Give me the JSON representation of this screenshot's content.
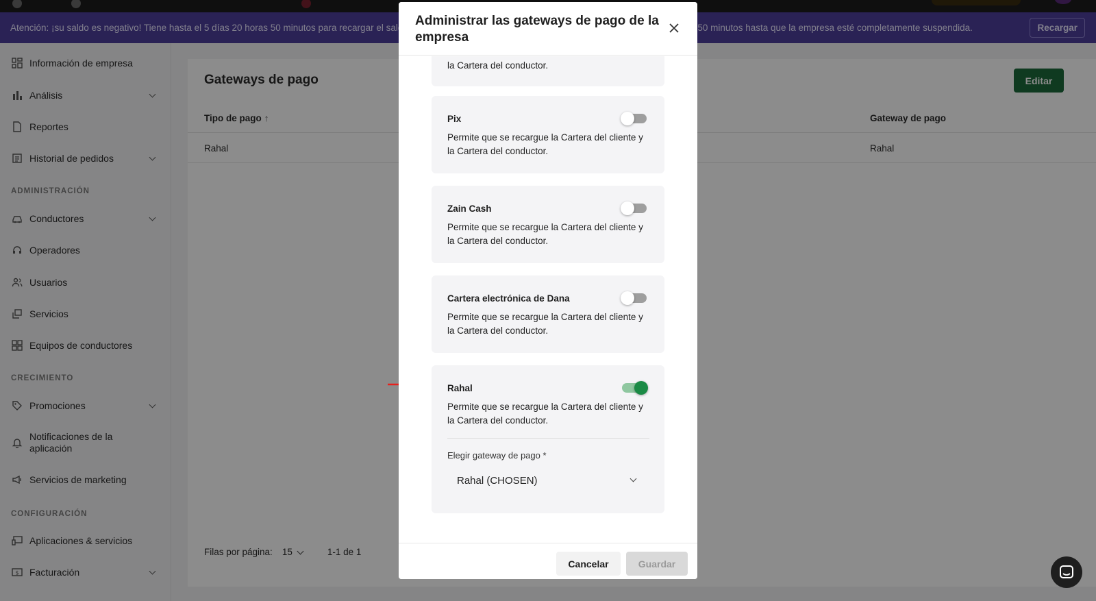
{
  "banner": {
    "text": "Atención: ¡su saldo es negativo! Tiene hasta el 5 días 20 horas 50 minutos para recargar el saldo antes de que la empresa quede suspendida. Quedan 5 días 20 horas 50 minutos hasta que la empresa esté completamente suspendida.",
    "button_label": "Recargar"
  },
  "sidebar": {
    "items": [
      {
        "label": "Información de empresa",
        "icon": "grid-icon"
      },
      {
        "label": "Análisis",
        "icon": "bar-chart-icon"
      },
      {
        "label": "Reportes",
        "icon": "document-icon"
      },
      {
        "label": "Historial de pedidos",
        "icon": "list-icon"
      },
      {
        "label": "Conductores",
        "icon": "car-icon"
      },
      {
        "label": "Operadores",
        "icon": "headset-icon"
      },
      {
        "label": "Usuarios",
        "icon": "users-icon"
      },
      {
        "label": "Servicios",
        "icon": "layers-icon"
      },
      {
        "label": "Equipos de conductores",
        "icon": "team-grid-icon"
      },
      {
        "label": "Promociones",
        "icon": "tag-icon"
      },
      {
        "label": "Notificaciones de la aplicación",
        "icon": "bell-icon"
      },
      {
        "label": "Servicios de marketing",
        "icon": "megaphone-icon"
      },
      {
        "label": "Aplicaciones & servicios",
        "icon": "devices-icon"
      },
      {
        "label": "Facturación",
        "icon": "dollar-icon"
      }
    ],
    "sections": [
      "ADMINISTRACIÓN",
      "CRECIMIENTO",
      "CONFIGURACIÓN"
    ]
  },
  "main": {
    "title": "Gateways de pago",
    "edit_label": "Editar",
    "columns": [
      "Tipo de pago",
      "Gateway de pago"
    ],
    "rows": [
      [
        "Rahal",
        "Rahal"
      ]
    ],
    "pager": {
      "rows_label": "Filas por página:",
      "rows_value": "15",
      "range": "1-1 de 1"
    }
  },
  "modal": {
    "title": "Administrar las gateways de pago de la empresa",
    "cards": [
      {
        "name": "",
        "desc": "la Cartera del conductor.",
        "enabled": false
      },
      {
        "name": "Pix",
        "desc": "Permite que se recargue la Cartera del cliente y la Cartera del conductor.",
        "enabled": false
      },
      {
        "name": "Zain Cash",
        "desc": "Permite que se recargue la Cartera del cliente y la Cartera del conductor.",
        "enabled": false
      },
      {
        "name": "Cartera electrónica de Dana",
        "desc": "Permite que se recargue la Cartera del cliente y la Cartera del conductor.",
        "enabled": false
      },
      {
        "name": "Rahal",
        "desc": "Permite que se recargue la Cartera del cliente y la Cartera del conductor.",
        "enabled": true
      }
    ],
    "select_label": "Elegir gateway de pago *",
    "select_value": "Rahal (CHOSEN)",
    "cancel_label": "Cancelar",
    "save_label": "Guardar"
  },
  "colors": {
    "accent": "#1d6a3b",
    "banner": "#4e3f9c",
    "toggle_on": "#1a8a45",
    "arrow": "#e8201c"
  }
}
